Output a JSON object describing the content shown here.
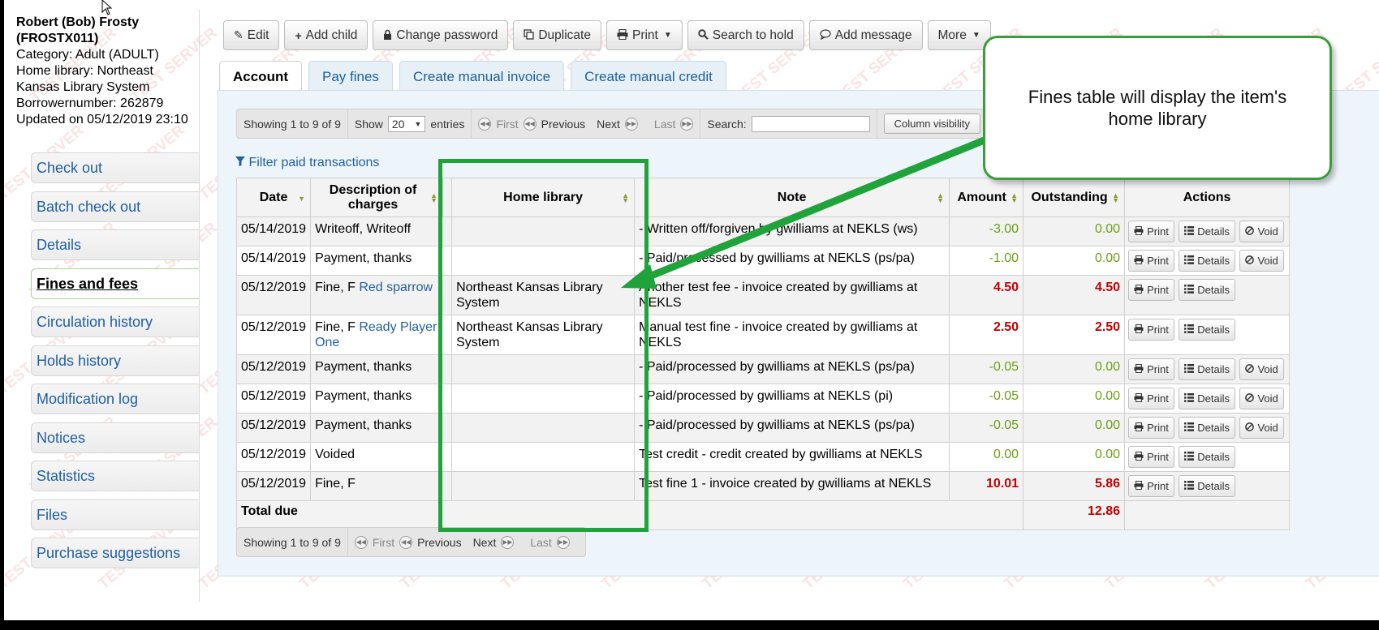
{
  "patron": {
    "name_line1": "Robert (Bob) Frosty",
    "name_line2": "(FROSTX011)",
    "category": "Category: Adult (ADULT)",
    "home_library_1": "Home library: Northeast",
    "home_library_2": "Kansas Library System",
    "borrowernumber": "Borrowernumber: 262879",
    "updated": "Updated on 05/12/2019 23:10"
  },
  "sidebar": {
    "items": [
      {
        "label": "Check out"
      },
      {
        "label": "Batch check out"
      },
      {
        "label": "Details"
      },
      {
        "label": "Fines and fees"
      },
      {
        "label": "Circulation history"
      },
      {
        "label": "Holds history"
      },
      {
        "label": "Modification log"
      },
      {
        "label": "Notices"
      },
      {
        "label": "Statistics"
      },
      {
        "label": "Files"
      },
      {
        "label": "Purchase suggestions"
      }
    ]
  },
  "toolbar": {
    "edit": "Edit",
    "add_child": "Add child",
    "change_password": "Change password",
    "duplicate": "Duplicate",
    "print": "Print",
    "search_to_hold": "Search to hold",
    "add_message": "Add message",
    "more": "More"
  },
  "tabs": {
    "account": "Account",
    "pay_fines": "Pay fines",
    "manual_invoice": "Create manual invoice",
    "manual_credit": "Create manual credit"
  },
  "pager": {
    "showing": "Showing 1 to 9 of 9",
    "show": "Show",
    "entries_value": "20",
    "entries": "entries",
    "first": "First",
    "previous": "Previous",
    "next": "Next",
    "last": "Last",
    "search": "Search:",
    "column_visibility": "Column visibility"
  },
  "filter_link": "Filter paid transactions",
  "table": {
    "headers": {
      "date": "Date",
      "desc_1": "Description of",
      "desc_2": "charges",
      "home_library": "Home library",
      "note": "Note",
      "amount": "Amount",
      "outstanding": "Outstanding",
      "actions": "Actions"
    },
    "rows": [
      {
        "date": "05/14/2019",
        "desc": "Writeoff, Writeoff",
        "link": "",
        "lib": "",
        "note": "- Written off/forgiven by gwilliams at NEKLS (ws)",
        "amount": "-3.00",
        "outstanding": "0.00",
        "void": true
      },
      {
        "date": "05/14/2019",
        "desc": "Payment, thanks",
        "link": "",
        "lib": "",
        "note": "- Paid/processed by gwilliams at NEKLS (ps/pa)",
        "amount": "-1.00",
        "outstanding": "0.00",
        "void": true
      },
      {
        "date": "05/12/2019",
        "desc": "Fine, F",
        "link": "Red sparrow",
        "lib": "Northeast Kansas Library System",
        "note": "Another test fee - invoice created by gwilliams at NEKLS",
        "amount": "4.50",
        "outstanding": "4.50",
        "void": false
      },
      {
        "date": "05/12/2019",
        "desc": "Fine, F",
        "link": "Ready Player One",
        "lib": "Northeast Kansas Library System",
        "note": "Manual test fine - invoice created by gwilliams at NEKLS",
        "amount": "2.50",
        "outstanding": "2.50",
        "void": false
      },
      {
        "date": "05/12/2019",
        "desc": "Payment, thanks",
        "link": "",
        "lib": "",
        "note": "- Paid/processed by gwilliams at NEKLS (ps/pa)",
        "amount": "-0.05",
        "outstanding": "0.00",
        "void": true
      },
      {
        "date": "05/12/2019",
        "desc": "Payment, thanks",
        "link": "",
        "lib": "",
        "note": "- Paid/processed by gwilliams at NEKLS (pi)",
        "amount": "-0.05",
        "outstanding": "0.00",
        "void": true
      },
      {
        "date": "05/12/2019",
        "desc": "Payment, thanks",
        "link": "",
        "lib": "",
        "note": "- Paid/processed by gwilliams at NEKLS (ps/pa)",
        "amount": "-0.05",
        "outstanding": "0.00",
        "void": true
      },
      {
        "date": "05/12/2019",
        "desc": "Voided",
        "link": "",
        "lib": "",
        "note": "Test credit - credit created by gwilliams at NEKLS",
        "amount": "0.00",
        "outstanding": "0.00",
        "void": false
      },
      {
        "date": "05/12/2019",
        "desc": "Fine, F",
        "link": "",
        "lib": "",
        "note": "Test fine 1 - invoice created by gwilliams at NEKLS",
        "amount": "10.01",
        "outstanding": "5.86",
        "void": false
      }
    ],
    "action_labels": {
      "print": "Print",
      "details": "Details",
      "void": "Void"
    },
    "total_label": "Total due",
    "total_value": "12.86"
  },
  "watermark": "TEST SERVER",
  "callout": {
    "line1": "Fines table will display the item's",
    "line2": "home library"
  },
  "colors": {
    "accent_green": "#1fa33a",
    "link_blue": "#2160a0",
    "debt_red": "#c00000",
    "credit_green": "#6d9c14"
  },
  "icons": {
    "edit": "pencil-icon",
    "add_child": "plus-icon",
    "change_password": "lock-icon",
    "duplicate": "copy-icon",
    "print": "printer-icon",
    "search": "magnifier-icon",
    "message": "speech-bubble-icon",
    "filter": "funnel-icon",
    "details": "list-icon",
    "void": "ban-icon"
  }
}
